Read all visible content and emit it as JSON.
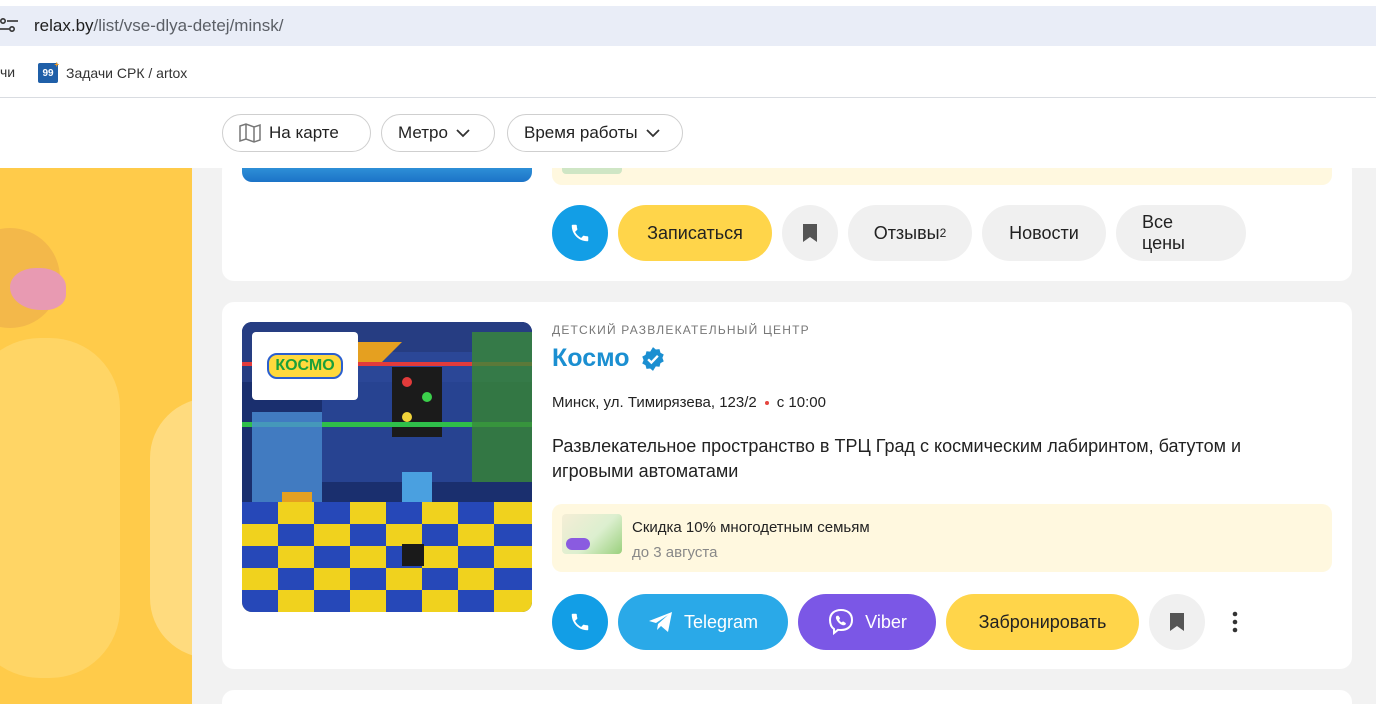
{
  "browser": {
    "url_host": "relax.by",
    "url_path": "/list/vse-dlya-detej/minsk/",
    "bookmarks": {
      "partial_label": "чи",
      "item_label": "Задачи СРК / artox",
      "item_favicon_text": "99",
      "item_favicon_sup": "+"
    }
  },
  "filters": {
    "map_label": "На карте",
    "metro_label": "Метро",
    "hours_label": "Время работы"
  },
  "previous_card": {
    "actions": {
      "signup_label": "Записаться",
      "reviews_label": "Отзывы",
      "reviews_count": "2",
      "news_label": "Новости",
      "prices_label": "Все цены"
    }
  },
  "listing": {
    "category": "ДЕТСКИЙ РАЗВЛЕКАТЕЛЬНЫЙ ЦЕНТР",
    "title": "Космо",
    "logo_text": "КОСМО",
    "address": "Минск, ул. Тимирязева, 123/2",
    "hours": "с 10:00",
    "description": "Развлекательное пространство в ТРЦ Град с космическим лабиринтом, батутом и игровыми автоматами",
    "promo": {
      "title": "Скидка 10% многодетным семьям",
      "until": "до 3 августа"
    },
    "actions": {
      "telegram_label": "Telegram",
      "viber_label": "Viber",
      "book_label": "Забронировать"
    }
  },
  "colors": {
    "accent_blue": "#1b8fd1",
    "phone_blue": "#129ee6",
    "telegram_blue": "#2aa9e8",
    "viber_purple": "#7b57e6",
    "cta_yellow": "#ffd54a",
    "promo_bg": "#fff8df"
  }
}
